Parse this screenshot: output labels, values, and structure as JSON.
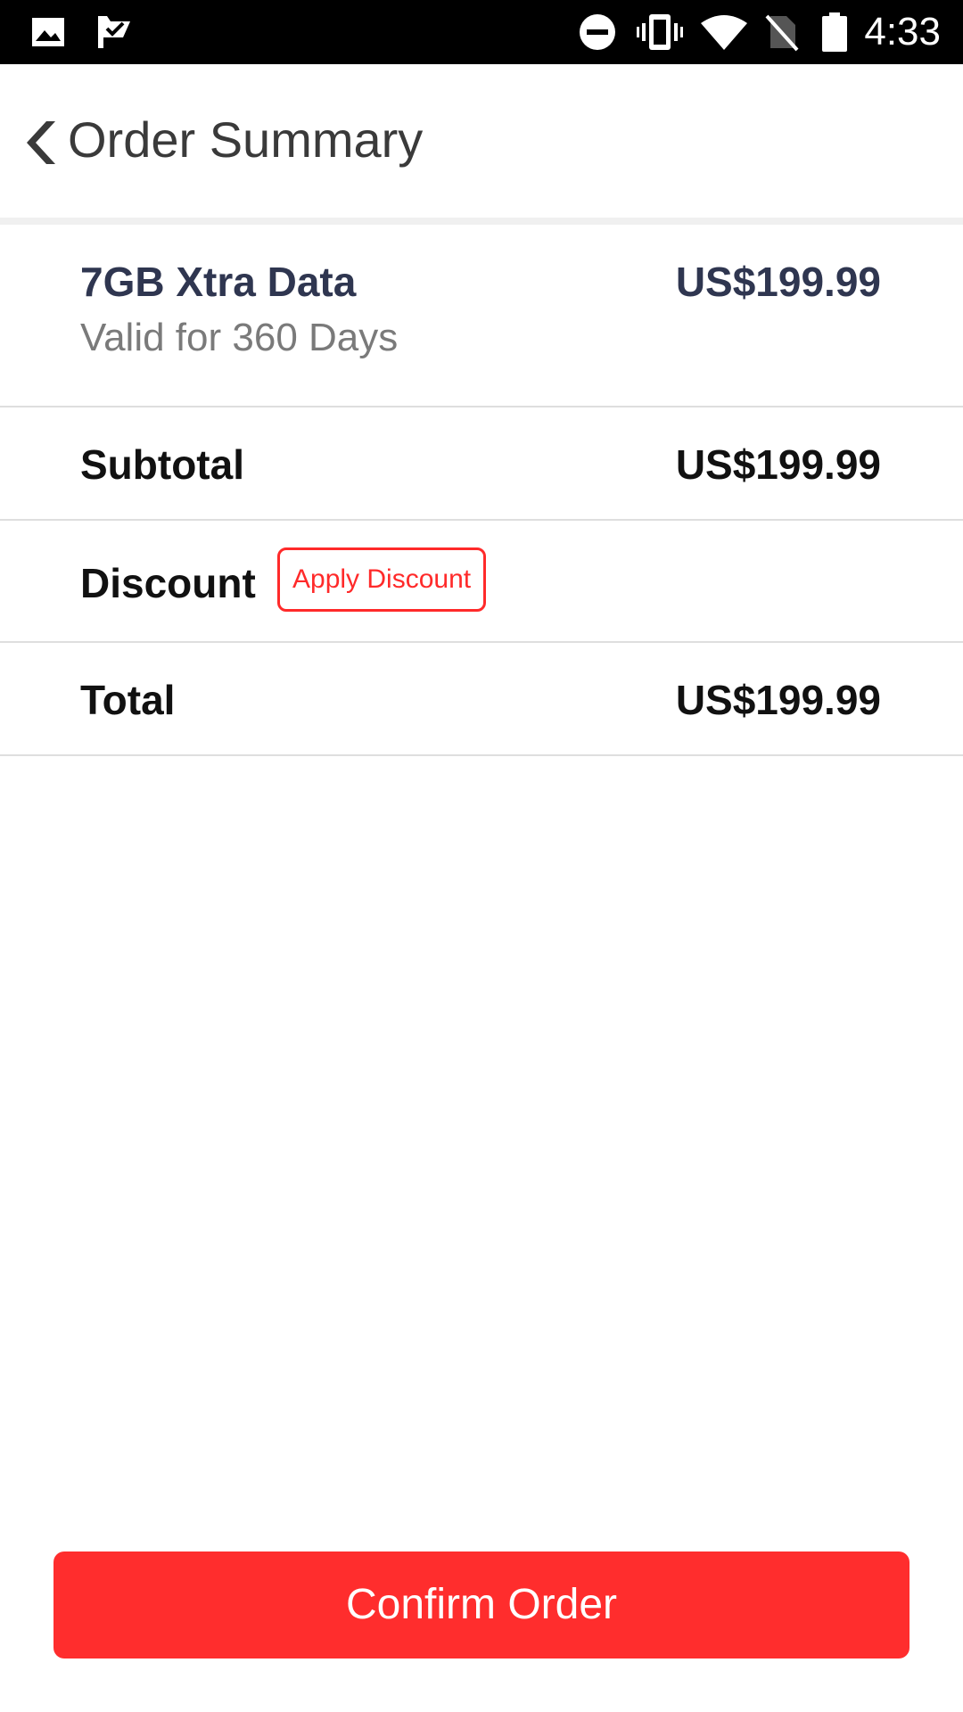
{
  "status_bar": {
    "time": "4:33",
    "left_icons": [
      "image-icon",
      "checkmark-flag-icon"
    ],
    "right_icons": [
      "do-not-disturb-icon",
      "vibrate-icon",
      "wifi-icon",
      "no-sim-icon",
      "battery-icon"
    ]
  },
  "header": {
    "back_icon": "chevron-left-icon",
    "title": "Order Summary"
  },
  "order": {
    "product_name": "7GB Xtra Data",
    "product_validity": "Valid for 360 Days",
    "product_price": "US$199.99",
    "subtotal_label": "Subtotal",
    "subtotal_value": "US$199.99",
    "discount_label": "Discount",
    "apply_discount_label": "Apply Discount",
    "total_label": "Total",
    "total_value": "US$199.99"
  },
  "footer": {
    "confirm_label": "Confirm Order"
  },
  "colors": {
    "accent": "#ff2d2d",
    "product_text": "#2f3650",
    "status_bar": "#000000"
  }
}
